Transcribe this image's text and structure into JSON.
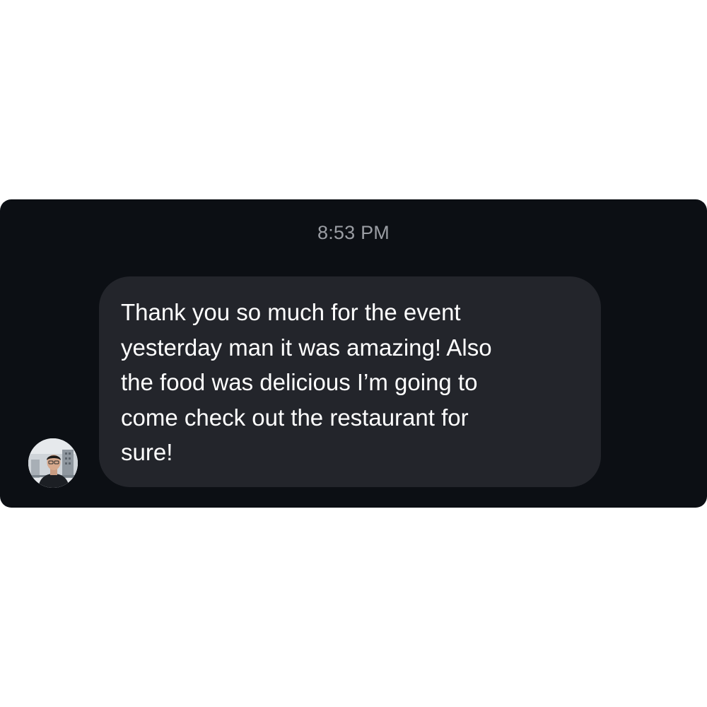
{
  "conversation": {
    "timestamp": "8:53 PM",
    "messages": [
      {
        "direction": "incoming",
        "text": "Thank you so much for the event\nyesterday man it was amazing! Also\nthe food was delicious I’m going to\ncome check out the restaurant for\nsure!"
      }
    ]
  },
  "colors": {
    "panel_background": "#0c0f14",
    "bubble_background": "#23252b",
    "message_text": "#ffffff",
    "timestamp_text": "#9a9da3"
  }
}
